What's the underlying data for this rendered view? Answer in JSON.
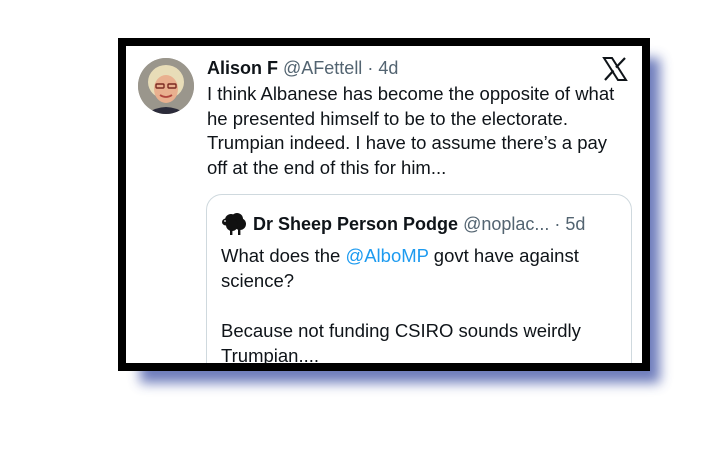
{
  "tweet": {
    "author_name": "Alison F",
    "handle": "@AFettell",
    "separator": " · ",
    "time": "4d",
    "text": "I think Albanese has become the opposite of what he presented himself to be to the electorate. Trumpian indeed. I have to assume there’s a pay off at the end of this for him..."
  },
  "quoted_tweet": {
    "author_name": "Dr Sheep Person Podge",
    "handle": "@noplac...",
    "separator": " · ",
    "time": "5d",
    "text_before_mention": "What does the ",
    "mention": "@AlboMP",
    "text_after_mention": " govt have against science?",
    "text_paragraph_2": "Because not funding CSIRO sounds weirdly Trumpian...."
  },
  "icons": {
    "platform_logo": "x-logo-icon",
    "quoted_avatar": "sheep-icon"
  },
  "colors": {
    "frame": "#000000",
    "shadow": "#5566b0",
    "mention": "#1d9bf0",
    "handle": "#536471",
    "text": "#0f1419"
  }
}
